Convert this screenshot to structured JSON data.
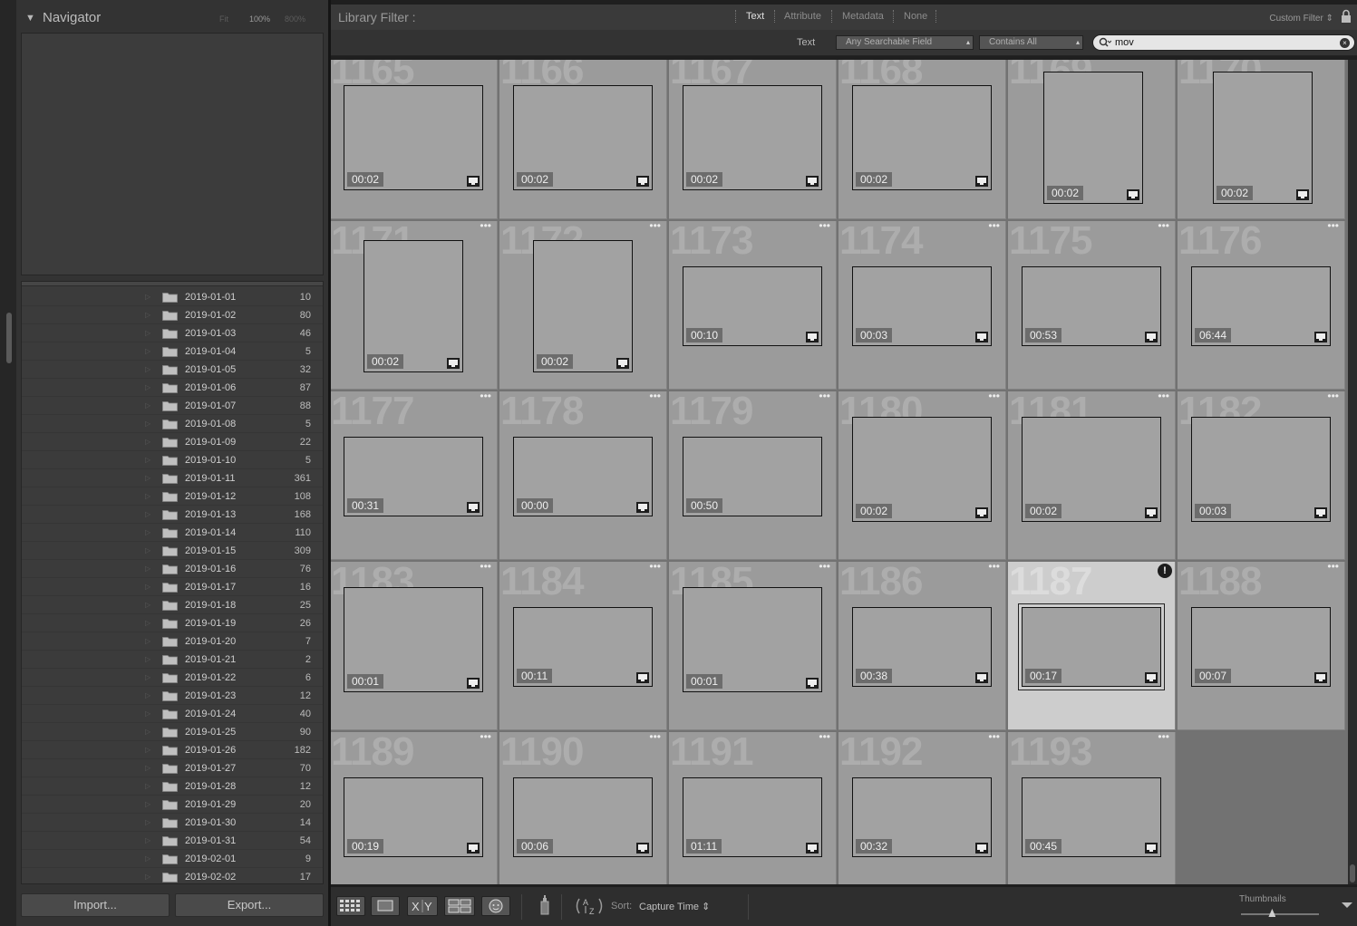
{
  "navigator": {
    "title": "Navigator",
    "zoom_options": [
      "Fit",
      "100%",
      "800%"
    ]
  },
  "folders": [
    {
      "name": "2019-01-01",
      "count": "10"
    },
    {
      "name": "2019-01-02",
      "count": "80"
    },
    {
      "name": "2019-01-03",
      "count": "46"
    },
    {
      "name": "2019-01-04",
      "count": "5"
    },
    {
      "name": "2019-01-05",
      "count": "32"
    },
    {
      "name": "2019-01-06",
      "count": "87"
    },
    {
      "name": "2019-01-07",
      "count": "88"
    },
    {
      "name": "2019-01-08",
      "count": "5"
    },
    {
      "name": "2019-01-09",
      "count": "22"
    },
    {
      "name": "2019-01-10",
      "count": "5"
    },
    {
      "name": "2019-01-11",
      "count": "361"
    },
    {
      "name": "2019-01-12",
      "count": "108"
    },
    {
      "name": "2019-01-13",
      "count": "168"
    },
    {
      "name": "2019-01-14",
      "count": "110"
    },
    {
      "name": "2019-01-15",
      "count": "309"
    },
    {
      "name": "2019-01-16",
      "count": "76"
    },
    {
      "name": "2019-01-17",
      "count": "16"
    },
    {
      "name": "2019-01-18",
      "count": "25"
    },
    {
      "name": "2019-01-19",
      "count": "26"
    },
    {
      "name": "2019-01-20",
      "count": "7"
    },
    {
      "name": "2019-01-21",
      "count": "2"
    },
    {
      "name": "2019-01-22",
      "count": "6"
    },
    {
      "name": "2019-01-23",
      "count": "12"
    },
    {
      "name": "2019-01-24",
      "count": "40"
    },
    {
      "name": "2019-01-25",
      "count": "90"
    },
    {
      "name": "2019-01-26",
      "count": "182"
    },
    {
      "name": "2019-01-27",
      "count": "70"
    },
    {
      "name": "2019-01-28",
      "count": "12"
    },
    {
      "name": "2019-01-29",
      "count": "20"
    },
    {
      "name": "2019-01-30",
      "count": "14"
    },
    {
      "name": "2019-01-31",
      "count": "54"
    },
    {
      "name": "2019-02-01",
      "count": "9"
    },
    {
      "name": "2019-02-02",
      "count": "17"
    }
  ],
  "buttons": {
    "import": "Import...",
    "export": "Export..."
  },
  "filter_bar": {
    "title": "Library Filter :",
    "tabs": [
      "Text",
      "Attribute",
      "Metadata",
      "None"
    ],
    "active_tab": "Text",
    "preset": "Custom Filter"
  },
  "text_filter": {
    "label": "Text",
    "field": "Any Searchable Field",
    "rule": "Contains All",
    "query": "mov"
  },
  "grid": {
    "columns": 6,
    "cells": [
      {
        "index": "1165",
        "duration": "00:02",
        "orientation": "landscape"
      },
      {
        "index": "1166",
        "duration": "00:02",
        "orientation": "landscape"
      },
      {
        "index": "1167",
        "duration": "00:02",
        "orientation": "landscape"
      },
      {
        "index": "1168",
        "duration": "00:02",
        "orientation": "landscape"
      },
      {
        "index": "1169",
        "duration": "00:02",
        "orientation": "portrait"
      },
      {
        "index": "1170",
        "duration": "00:02",
        "orientation": "portrait"
      },
      {
        "index": "1171",
        "duration": "00:02",
        "orientation": "portrait-tall"
      },
      {
        "index": "1172",
        "duration": "00:02",
        "orientation": "portrait-tall"
      },
      {
        "index": "1173",
        "duration": "00:10",
        "orientation": "wide"
      },
      {
        "index": "1174",
        "duration": "00:03",
        "orientation": "wide"
      },
      {
        "index": "1175",
        "duration": "00:53",
        "orientation": "wide"
      },
      {
        "index": "1176",
        "duration": "06:44",
        "orientation": "wide"
      },
      {
        "index": "1177",
        "duration": "00:31",
        "orientation": "wide"
      },
      {
        "index": "1178",
        "duration": "00:00",
        "orientation": "wide"
      },
      {
        "index": "1179",
        "duration": "00:50",
        "orientation": "wide-noicon"
      },
      {
        "index": "1180",
        "duration": "00:02",
        "orientation": "landscape"
      },
      {
        "index": "1181",
        "duration": "00:02",
        "orientation": "landscape"
      },
      {
        "index": "1182",
        "duration": "00:03",
        "orientation": "landscape"
      },
      {
        "index": "1183",
        "duration": "00:01",
        "orientation": "landscape"
      },
      {
        "index": "1184",
        "duration": "00:11",
        "orientation": "wide"
      },
      {
        "index": "1185",
        "duration": "00:01",
        "orientation": "landscape"
      },
      {
        "index": "1186",
        "duration": "00:38",
        "orientation": "wide"
      },
      {
        "index": "1187",
        "duration": "00:17",
        "orientation": "wide",
        "selected": true,
        "badge": "!"
      },
      {
        "index": "1188",
        "duration": "00:07",
        "orientation": "wide"
      },
      {
        "index": "1189",
        "duration": "00:19",
        "orientation": "wide"
      },
      {
        "index": "1190",
        "duration": "00:06",
        "orientation": "wide"
      },
      {
        "index": "1191",
        "duration": "01:11",
        "orientation": "wide"
      },
      {
        "index": "1192",
        "duration": "00:32",
        "orientation": "wide"
      },
      {
        "index": "1193",
        "duration": "00:45",
        "orientation": "wide"
      }
    ],
    "more_glyph": "•••"
  },
  "toolbar": {
    "sort_label": "Sort:",
    "sort_value": "Capture Time",
    "thumbnails_label": "Thumbnails",
    "thumbnail_size": 0.4,
    "icons": [
      "grid-view-icon",
      "loupe-view-icon",
      "compare-view-icon",
      "survey-view-icon",
      "people-view-icon",
      "spray-can-icon",
      "sort-direction-icon"
    ]
  },
  "colors": {
    "cell": "#9b9b9b",
    "cell_selected": "#cdcdcd",
    "panel": "#333333",
    "accent_text": "#e0e0e0"
  }
}
